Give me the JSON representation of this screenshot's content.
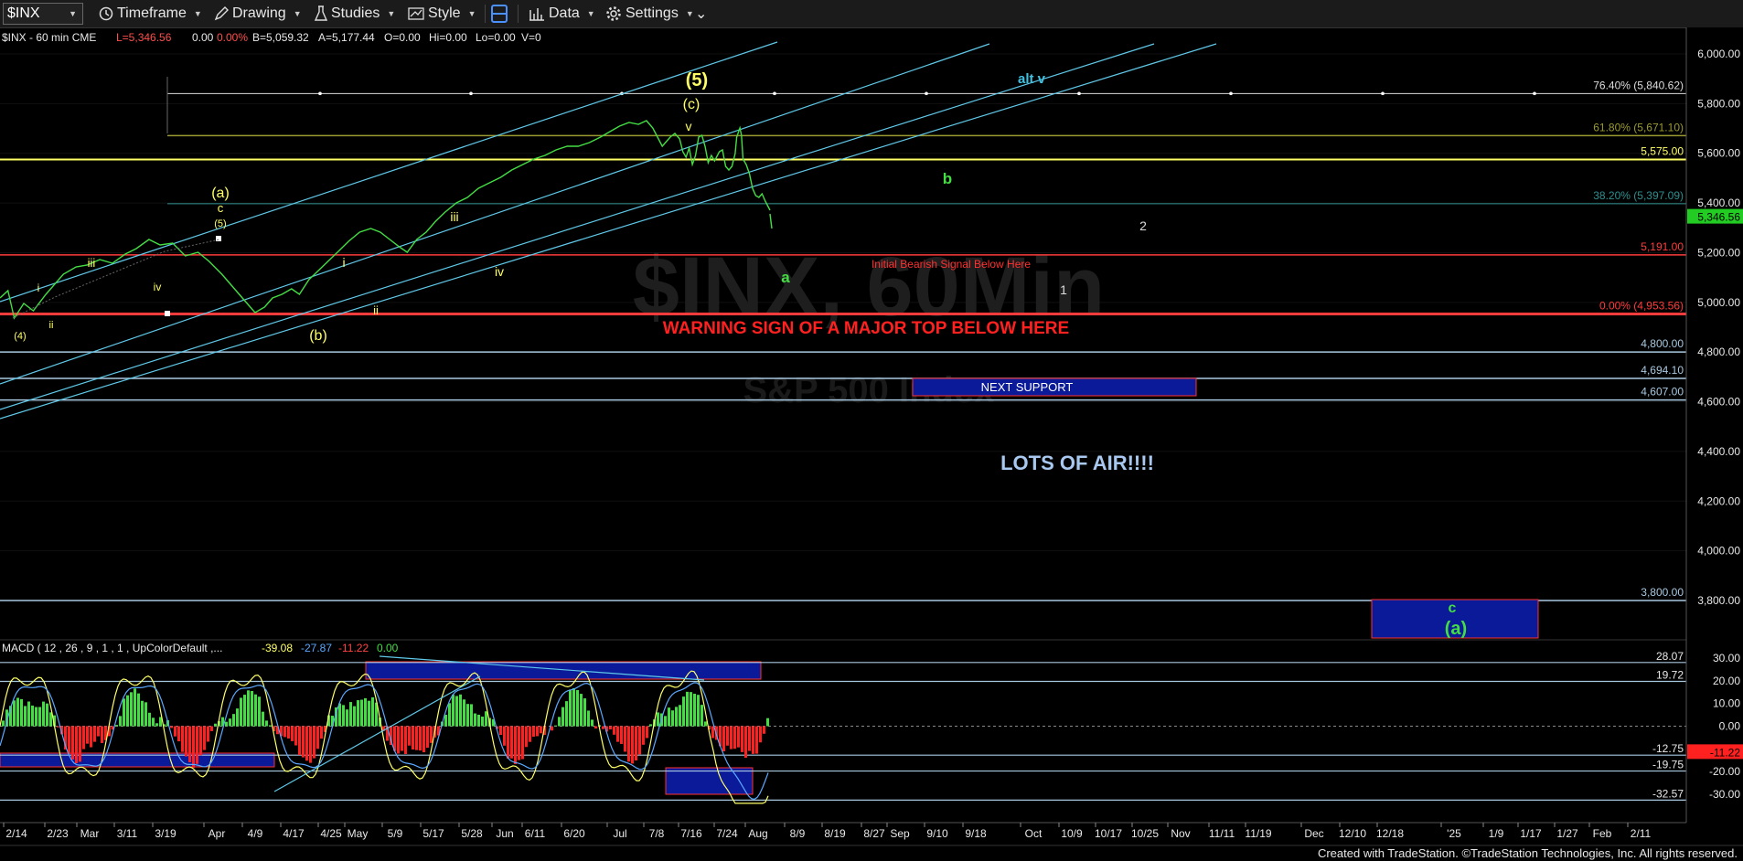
{
  "toolbar": {
    "symbol": "$INX",
    "timeframe": "Timeframe",
    "drawing": "Drawing",
    "studies": "Studies",
    "style": "Style",
    "data": "Data",
    "settings": "Settings"
  },
  "chart_data": {
    "type": "line",
    "header": "$INX - 60 min  CME",
    "quote": {
      "last": "L=5,346.56",
      "change": "0.00",
      "change_pct": "0.00%",
      "bid": "B=5,059.32",
      "ask": "A=5,177.44",
      "open": "O=0.00",
      "high": "Hi=0.00",
      "low": "Lo=0.00",
      "volume": "V=0"
    },
    "watermark": [
      "$INX, 60Min",
      "S&P 500 Index"
    ],
    "last_price_tag": "5,346.56",
    "ylim": [
      3600,
      6080
    ],
    "price_ticks": [
      "6,000.00",
      "5,800.00",
      "5,600.00",
      "5,400.00",
      "5,200.00",
      "5,000.00",
      "4,800.00",
      "4,600.00",
      "4,400.00",
      "4,200.00",
      "4,000.00",
      "3,800.00"
    ],
    "price_tick_values": [
      6000,
      5800,
      5600,
      5400,
      5200,
      5000,
      4800,
      4600,
      4400,
      4200,
      4000,
      3800
    ],
    "horizontal_levels": [
      {
        "value": 5840.62,
        "label": "76.40% (5,840.62)",
        "color": "#dcdcdc",
        "style": "dotted"
      },
      {
        "value": 5671.1,
        "label": "61.80% (5,671.10)",
        "color": "#9a9a30"
      },
      {
        "value": 5575.0,
        "label": "5,575.00",
        "color": "#ffff66"
      },
      {
        "value": 5397.09,
        "label": "38.20% (5,397.09)",
        "color": "#2f8f8f"
      },
      {
        "value": 5191.0,
        "label": "5,191.00",
        "color": "#ff3b3b"
      },
      {
        "value": 4953.56,
        "label": "0.00% (4,953.56)",
        "color": "#ff3b3b"
      },
      {
        "value": 4800.0,
        "label": "4,800.00",
        "color": "#a8c8e0"
      },
      {
        "value": 4694.1,
        "label": "4,694.10",
        "color": "#a8c8e0"
      },
      {
        "value": 4607.0,
        "label": "4,607.00",
        "color": "#a8c8e0"
      },
      {
        "value": 3800.0,
        "label": "3,800.00",
        "color": "#a8c8e0"
      }
    ],
    "price_series": {
      "name": "$INX",
      "x": [
        "2/14",
        "2/23",
        "Mar",
        "3/11",
        "3/19",
        "Apr",
        "4/9",
        "4/17",
        "4/25",
        "May",
        "5/9",
        "5/17",
        "5/28",
        "Jun",
        "6/11",
        "6/20",
        "Jul",
        "7/8",
        "7/16",
        "7/24",
        "Aug"
      ],
      "values": [
        4960,
        5060,
        5100,
        5150,
        5200,
        5250,
        5190,
        4970,
        5040,
        5120,
        5250,
        5300,
        5250,
        5300,
        5350,
        5460,
        5520,
        5620,
        5660,
        5440,
        5346
      ]
    },
    "annotations": [
      {
        "text": "(5)",
        "color": "#ffff66"
      },
      {
        "text": "(c)",
        "color": "#ffff66"
      },
      {
        "text": "v",
        "color": "#ffff66"
      },
      {
        "text": "(a)",
        "color": "#ffff66"
      },
      {
        "text": "c",
        "color": "#ffff66"
      },
      {
        "text": "(5)",
        "color": "#ffff66"
      },
      {
        "text": "iii",
        "color": "#ffff66"
      },
      {
        "text": "iv",
        "color": "#ffff66"
      },
      {
        "text": "iii",
        "color": "#ffff66"
      },
      {
        "text": "i",
        "color": "#ffff66"
      },
      {
        "text": "ii",
        "color": "#ffff66"
      },
      {
        "text": "iv",
        "color": "#ffff66"
      },
      {
        "text": "i",
        "color": "#ffff66"
      },
      {
        "text": "ii",
        "color": "#ffff66"
      },
      {
        "text": "(4)",
        "color": "#ffff66"
      },
      {
        "text": "(b)",
        "color": "#ffff66"
      },
      {
        "text": "alt v",
        "color": "#40c0e0"
      },
      {
        "text": "b",
        "color": "#44dd44"
      },
      {
        "text": "a",
        "color": "#44dd44"
      },
      {
        "text": "2",
        "color": "#dddddd"
      },
      {
        "text": "1",
        "color": "#dddddd"
      },
      {
        "text": "c",
        "color": "#44dd44"
      },
      {
        "text": "(a)",
        "color": "#44dd44"
      }
    ],
    "notes": {
      "bearish_signal": "Initial Bearish Signal Below Here",
      "warning": "WARNING SIGN OF A MAJOR TOP BELOW HERE",
      "next_support": "NEXT SUPPORT",
      "lots_of_air": "LOTS OF AIR!!!!"
    },
    "macd": {
      "title": "MACD ( 12 , 26 , 9 , 1 , 1 , UpColorDefault ,...",
      "values": [
        "-39.08",
        "-27.87",
        "-11.22",
        "0.00"
      ],
      "value_colors": [
        "#ffff66",
        "#5ba8ff",
        "#ff4444",
        "#44dd44"
      ],
      "ylim": [
        -35,
        32
      ],
      "ticks": [
        "30.00",
        "20.00",
        "10.00",
        "0.00",
        "-10.00",
        "-20.00",
        "-30.00"
      ],
      "tick_values": [
        30,
        20,
        10,
        0,
        -10,
        -20,
        -30
      ],
      "levels": [
        {
          "value": 28.07,
          "label": "28.07"
        },
        {
          "value": 19.72,
          "label": "19.72"
        },
        {
          "value": -12.75,
          "label": "-12.75"
        },
        {
          "value": -19.75,
          "label": "-19.75"
        },
        {
          "value": -32.57,
          "label": "-32.57"
        }
      ],
      "last_tag": "-11.22"
    },
    "x_axis_labels": [
      "2/14",
      "2/23",
      "Mar",
      "3/11",
      "3/19",
      "Apr",
      "4/9",
      "4/17",
      "4/25",
      "May",
      "5/9",
      "5/17",
      "5/28",
      "Jun",
      "6/11",
      "6/20",
      "Jul",
      "7/8",
      "7/16",
      "7/24",
      "Aug",
      "8/9",
      "8/19",
      "8/27",
      "Sep",
      "9/10",
      "9/18",
      "Oct",
      "10/9",
      "10/17",
      "10/25",
      "Nov",
      "11/11",
      "11/19",
      "Dec",
      "12/10",
      "12/18",
      "'25",
      "1/9",
      "1/17",
      "1/27",
      "Feb",
      "2/11"
    ]
  },
  "footer": "Created with TradeStation. ©TradeStation Technologies, Inc. All rights reserved.",
  "colors": {
    "up": "#44dd44",
    "down": "#ff3030",
    "channel": "#5fc8e8",
    "support_box": "#0a1a99"
  }
}
